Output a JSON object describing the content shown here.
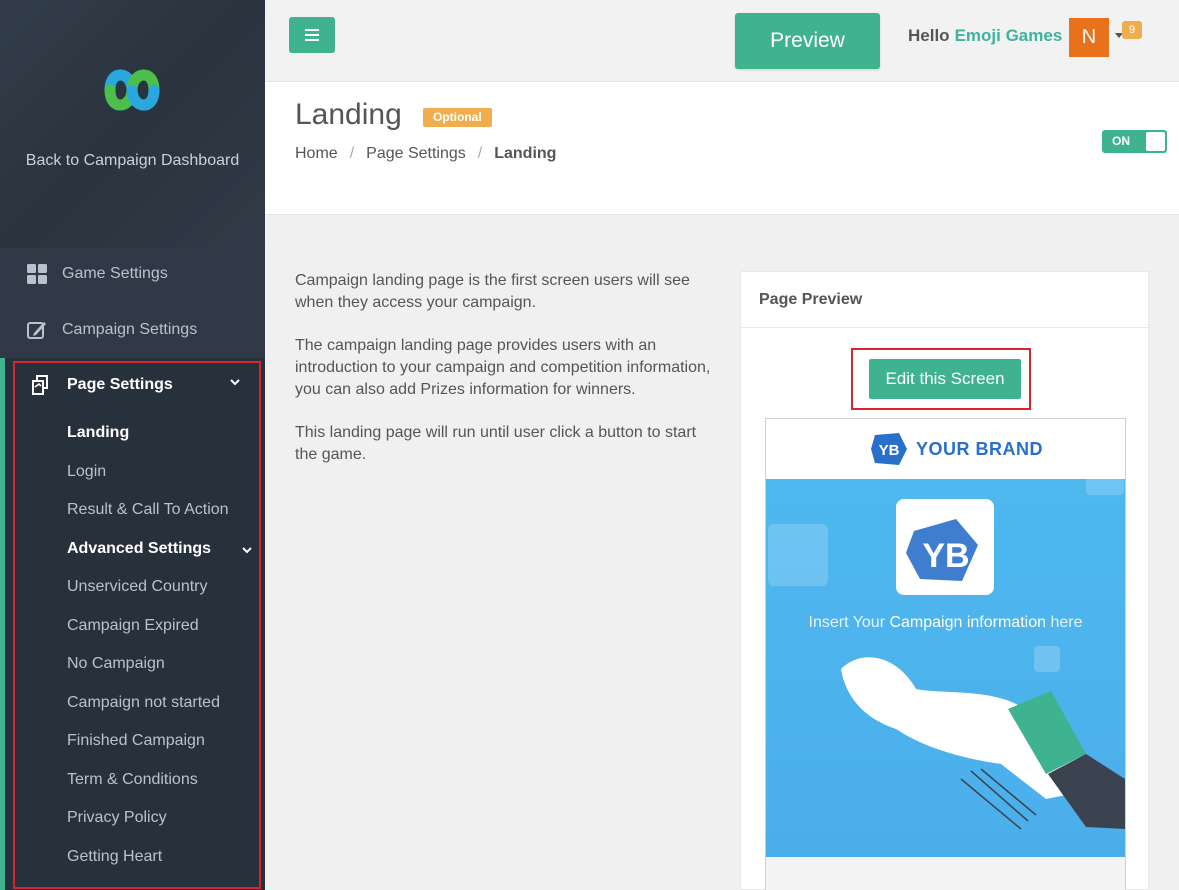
{
  "sidebar": {
    "back_link": "Back to Campaign Dashboard",
    "items": [
      {
        "label": "Game Settings",
        "icon": "grid-icon"
      },
      {
        "label": "Campaign Settings",
        "icon": "edit-icon"
      }
    ],
    "page_settings": {
      "label": "Page Settings",
      "icon": "pages-icon",
      "subitems": [
        {
          "label": "Landing",
          "active": true
        },
        {
          "label": "Login"
        },
        {
          "label": "Result & Call To Action"
        },
        {
          "label": "Advanced Settings",
          "active": true
        },
        {
          "label": "Unserviced Country"
        },
        {
          "label": "Campaign Expired"
        },
        {
          "label": "No Campaign"
        },
        {
          "label": "Campaign not started"
        },
        {
          "label": "Finished Campaign"
        },
        {
          "label": "Term & Conditions"
        },
        {
          "label": "Privacy Policy"
        },
        {
          "label": "Getting Heart"
        }
      ]
    }
  },
  "topbar": {
    "preview_label": "Preview",
    "hello": "Hello",
    "user_name": "Emoji Games",
    "avatar_letter": "N",
    "notification_count": "9"
  },
  "header": {
    "title": "Landing",
    "badge": "Optional",
    "breadcrumb": [
      "Home",
      "/",
      "Page Settings",
      "/",
      "Landing"
    ],
    "toggle_label": "ON"
  },
  "description": {
    "p1": "Campaign landing page is the first screen users will see when they access your campaign.",
    "p2": "The campaign landing page provides users with an introduction to your campaign and competition information, you can also add Prizes information for winners.",
    "p3": "This landing page will run until user click a button to start the game."
  },
  "preview_panel": {
    "title": "Page Preview",
    "edit_button": "Edit this Screen",
    "brand_name": "YOUR BRAND",
    "brand_logo_text": "YB",
    "hero_text_pre": "Insert Your",
    "hero_text_bold": "Campaign information",
    "hero_text_post": "here"
  },
  "colors": {
    "accent": "#3fb28f",
    "sidebar": "#2f3a46",
    "highlight": "#d9232d",
    "badge": "#f0ad4e",
    "avatar": "#e9711c"
  }
}
